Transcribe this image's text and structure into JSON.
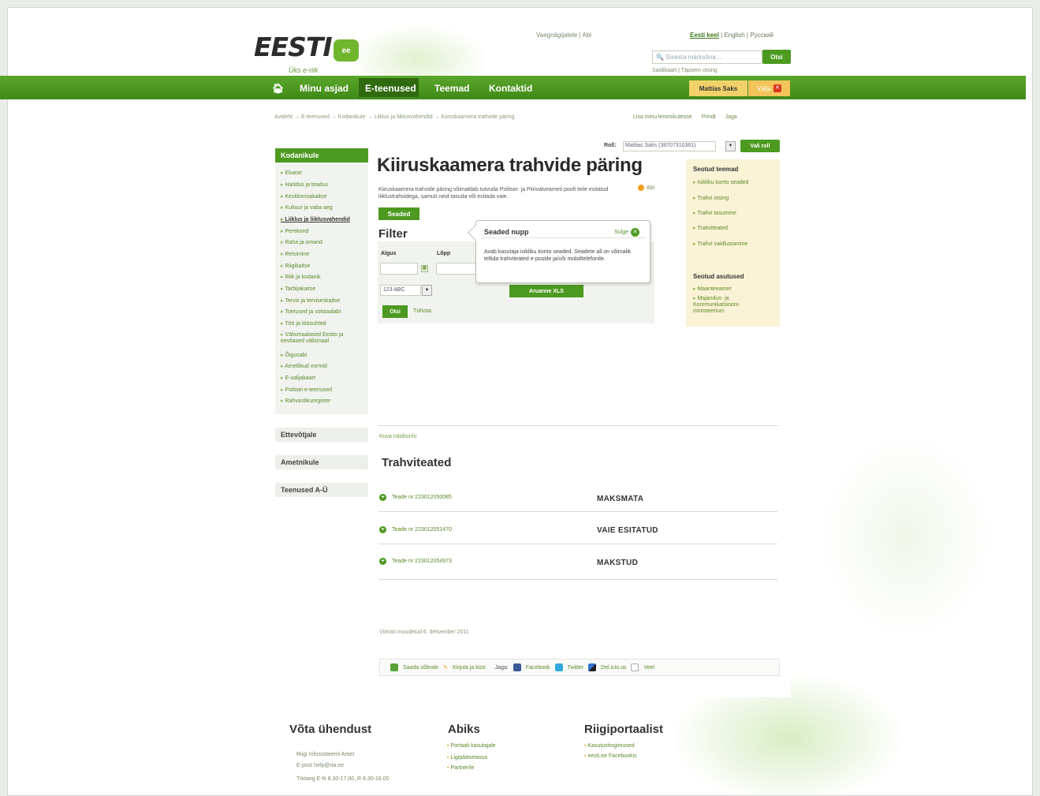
{
  "header": {
    "logo_text": "EESTI",
    "logo_badge": "ee",
    "slogan": "Üks e-riik",
    "top_links": "Vaegnägijatele | Abi",
    "languages": {
      "current": "Eesti keel",
      "others": " | English | Русский"
    },
    "search_placeholder": "Sisesta märksõna...",
    "search_button": "Otsi",
    "search_links": "Saidikaart | Täpsem otsing"
  },
  "nav": {
    "items": [
      "Minu asjad",
      "E-teenused",
      "Teemad",
      "Kontaktid"
    ],
    "active": "E-teenused",
    "user": "Mattias Saks",
    "exit": "Välju"
  },
  "breadcrumb": "Avaleht → E-teenused → Kodanikule → Liiklus ja liiklusvahendid → Kiiruskaamera trahvide päring",
  "page_actions": [
    "Lisa minu lemmikutesse",
    "Prindi",
    "Jaga"
  ],
  "sidebar": {
    "heading": "Kodanikule",
    "items": [
      "Eluase",
      "Haridus ja teadus",
      "Keskkonnakaitse",
      "Kultuur ja vaba aeg",
      "Liiklus ja liiklusvahendid",
      "Perekond",
      "Raha ja omand",
      "Reisimine",
      "Riigikaitse",
      "Riik ja kodanik",
      "Tarbijakaitse",
      "Tervis ja terviseskaitse",
      "Toetused ja sotsiaalabi",
      "Töö ja töösuhted",
      "Välismaalased Eestis ja eestlased välismaal",
      "Õigusabi",
      "Ametlikud vormid",
      "E-valijakaart",
      "Politsei e-teenused",
      "Rahvastikuregister"
    ],
    "current": "Liiklus ja liiklusvahendid",
    "categories": [
      "Ettevõtjale",
      "Ametnikule",
      "Teenused A-Ü"
    ]
  },
  "role": {
    "label": "Roll:",
    "value": "Mattias Saks (38707310361)",
    "button": "Vali roll"
  },
  "main": {
    "title": "Kiiruskaamera trahvide päring",
    "intro": "Kiiruskaamera trahvide päring võimaldab tutvuda Politsei- ja Piirivalveameti poolt teile esitatud liiklustrahvidega, samuti neid tasuda või esitada vaie.",
    "help": "Abi",
    "settings_button": "Seaded"
  },
  "filter": {
    "title": "Filter",
    "start_label": "Algus",
    "end_label": "Lõpp",
    "plate_value": "123 ABC",
    "search_button": "Otsi",
    "cancel_link": "Tühista",
    "xls_button": "Aruanne XLS"
  },
  "popup": {
    "title": "Seaded nupp",
    "close": "Sulge",
    "text": "Avab kasutaja isikliku konto seaded. Seadete all on võimalik tellida trahviteated e-postile ja/või mobiiltelefonile."
  },
  "related": {
    "topics_title": "Seotud teemad",
    "topics": [
      "Isikliku konto seaded",
      "Trahvi otsing",
      "Trahvi tasumine",
      "Trahviteated",
      "Trahvi vaidlustamine"
    ],
    "agencies_title": "Seotud asutused",
    "agencies": [
      "Maanteeamet",
      "Majandus- ja Kommunikatsiooni-ministeerium"
    ]
  },
  "notices": {
    "show_examples": "Kuva näidisinfo",
    "title": "Trahviteated",
    "items": [
      {
        "label": "Teade nr 223012050085",
        "status": "MAKSMATA"
      },
      {
        "label": "Teade nr 223012051470",
        "status": "VAIE ESITATUD"
      },
      {
        "label": "Teade nr 223012054973",
        "status": "MAKSTUD"
      }
    ]
  },
  "modified": "Viimati muudetud 6. detsember 2011",
  "social": {
    "send": "Saada sõbrale",
    "write": "Kirjuta ja küsi",
    "share": "Jaga:",
    "facebook": "Facebook",
    "twitter": "Twitter",
    "delicious": "Del.icio.us",
    "more": "Veel"
  },
  "footer": {
    "contact_title": "Võta ühendust",
    "contact_lines": [
      "Riigi Infosüsteemi Amet",
      "E-post help@ria.ee",
      "Tööaeg E-N 8.30-17.00, R 8.30-16.00"
    ],
    "help_title": "Abiks",
    "help_items": [
      "Portaali kasutajale",
      "Ligipääsetavus",
      "Partnerile"
    ],
    "portal_title": "Riigiportaalist",
    "portal_items": [
      "Kasutustingimused",
      "eesti.ee Facebookis"
    ]
  },
  "colors": {
    "brand_green": "#4d9a20",
    "nav_dark": "#2f6a10",
    "user_box": "#f2d16a",
    "related_bg": "#fbf3d6"
  }
}
